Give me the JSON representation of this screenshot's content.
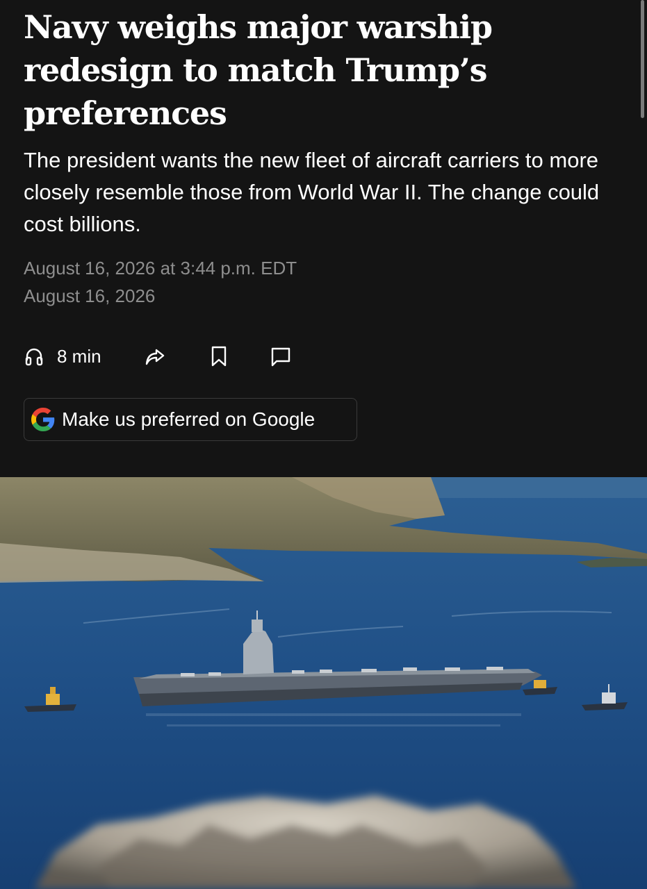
{
  "article": {
    "headline": "Navy weighs major warship redesign to match Trump’s preferences",
    "subheadline": "The president wants the new fleet of aircraft carriers to more closely resemble those from World War II. The change could cost billions.",
    "published": "August 16, 2026 at 3:44 p.m. EDT",
    "updated": "August 16, 2026"
  },
  "actions": {
    "listen_icon": "headphones-icon",
    "listen_label": "8 min",
    "share_icon": "share-arrow-icon",
    "save_icon": "bookmark-icon",
    "comment_icon": "comment-icon"
  },
  "google_button": {
    "icon": "google-g-icon",
    "label": "Make us preferred on Google"
  },
  "photo": {
    "subject": "aircraft carrier in bay with tugboats"
  },
  "colors": {
    "background": "#141414",
    "text": "#ffffff",
    "muted": "#8e8e8e",
    "border": "#3b3b3b",
    "sea": "#1f4f86"
  }
}
